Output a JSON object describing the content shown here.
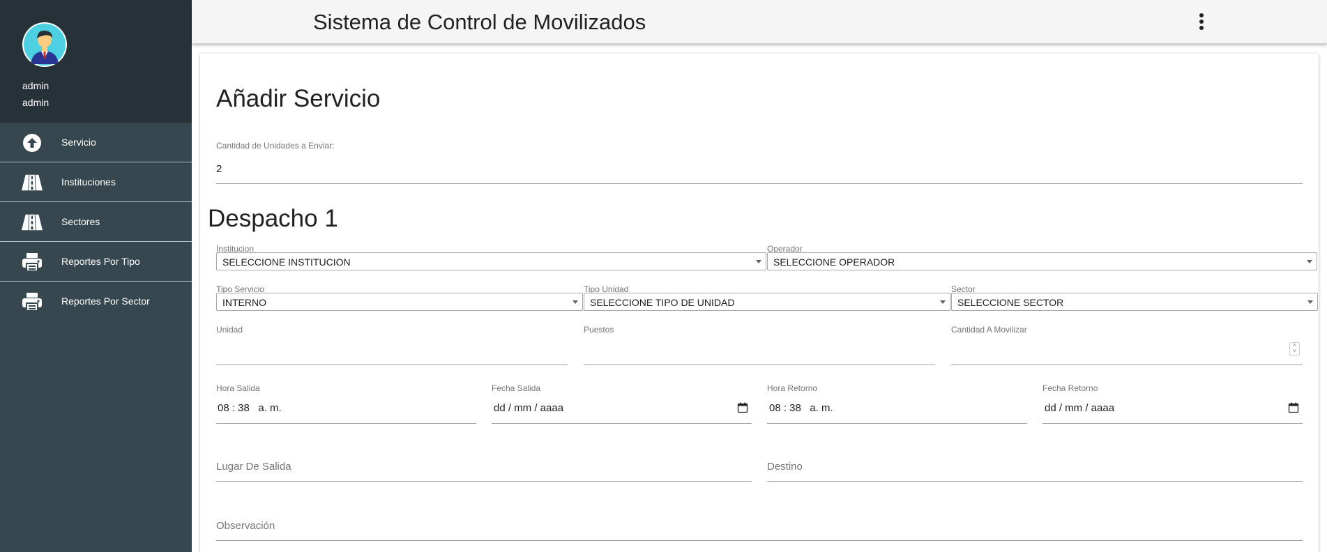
{
  "app": {
    "title": "Sistema de Control de Movilizados"
  },
  "user": {
    "name": "admin",
    "email": "admin"
  },
  "sidebar": {
    "items": [
      {
        "label": "Servicio",
        "icon": "arrow-up-circle-icon"
      },
      {
        "label": "Instituciones",
        "icon": "road-icon"
      },
      {
        "label": "Sectores",
        "icon": "road-icon"
      },
      {
        "label": "Reportes Por Tipo",
        "icon": "printer-icon"
      },
      {
        "label": "Reportes Por Sector",
        "icon": "printer-icon"
      }
    ]
  },
  "form": {
    "title": "Añadir Servicio",
    "units_label": "Cantidad de Unidades a Enviar:",
    "units_value": "2",
    "section_title": "Despacho 1",
    "institucion": {
      "label": "Institucion",
      "value": "SELECCIONE INSTITUCION"
    },
    "operador": {
      "label": "Operador",
      "value": "SELECCIONE OPERADOR"
    },
    "tipo_servicio": {
      "label": "Tipo Servicio",
      "value": "INTERNO"
    },
    "tipo_unidad": {
      "label": "Tipo Unidad",
      "value": "SELECCIONE TIPO DE UNIDAD"
    },
    "sector": {
      "label": "Sector",
      "value": "SELECCIONE SECTOR"
    },
    "unidad": {
      "label": "Unidad",
      "value": ""
    },
    "puestos": {
      "label": "Puestos",
      "value": ""
    },
    "cantidad": {
      "label": "Cantidad A Movilizar",
      "value": ""
    },
    "hora_salida": {
      "label": "Hora Salida",
      "value": "08 : 38   a. m."
    },
    "fecha_salida": {
      "label": "Fecha Salida",
      "value": "dd / mm / aaaa"
    },
    "hora_retorno": {
      "label": "Hora Retorno",
      "value": "08 : 38   a. m."
    },
    "fecha_retorno": {
      "label": "Fecha Retorno",
      "value": "dd / mm / aaaa"
    },
    "lugar_salida": {
      "placeholder": "Lugar De Salida"
    },
    "destino": {
      "placeholder": "Destino"
    },
    "observacion": {
      "placeholder": "Observación"
    }
  },
  "colors": {
    "sidebar_bg": "#37474f",
    "profile_bg": "#263238",
    "topbar_bg": "#f5f5f5",
    "avatar_accent": "#4dd0e1"
  }
}
